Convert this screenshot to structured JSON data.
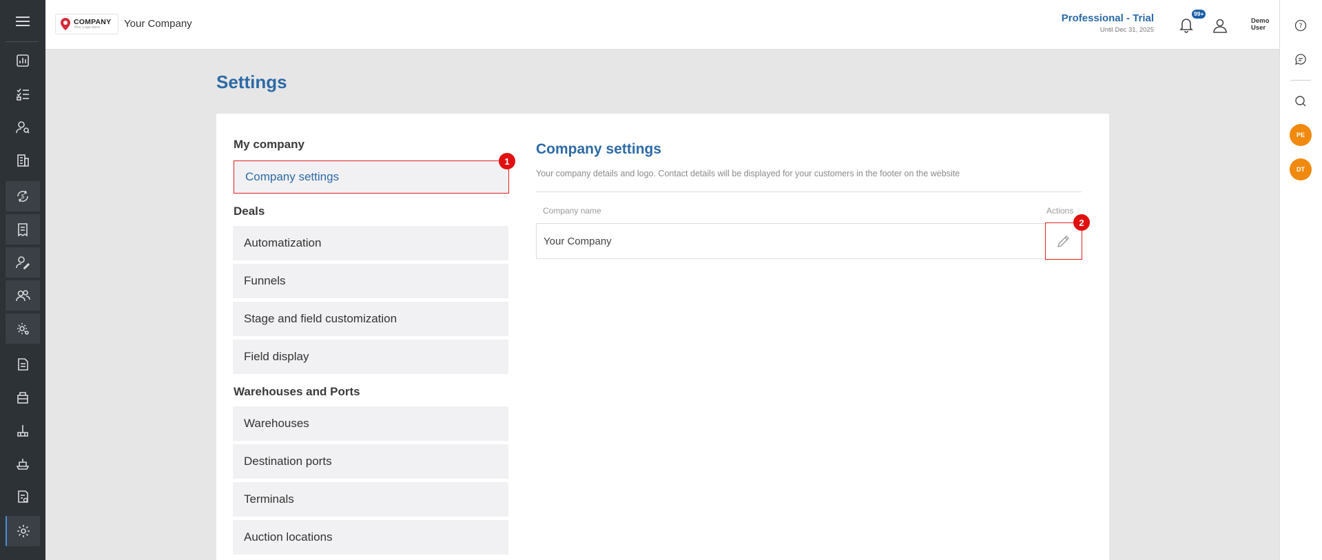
{
  "header": {
    "logo_main": "COMPANY",
    "logo_sub": "Your Logo Here",
    "company_name": "Your Company",
    "plan_title": "Professional - Trial",
    "plan_sub": "Until Dec 31, 2025",
    "notif_badge": "99+",
    "user_first": "Demo",
    "user_last": "User"
  },
  "page": {
    "title": "Settings"
  },
  "menu": {
    "sections": [
      {
        "title": "My company",
        "items": [
          "Company settings"
        ]
      },
      {
        "title": "Deals",
        "items": [
          "Automatization",
          "Funnels",
          "Stage and field customization",
          "Field display"
        ]
      },
      {
        "title": "Warehouses and Ports",
        "items": [
          "Warehouses",
          "Destination ports",
          "Terminals",
          "Auction locations"
        ]
      }
    ]
  },
  "company_settings": {
    "title": "Company settings",
    "description": "Your company details and logo. Contact details will be displayed for your customers in the footer on the website",
    "col_name": "Company name",
    "col_actions": "Actions",
    "row_value": "Your Company"
  },
  "markers": [
    "1",
    "2"
  ],
  "avatars": [
    "PE",
    "DT"
  ],
  "colors": {
    "accent": "#2c6aa6",
    "sidebar": "#2d3237",
    "marker": "#e01010",
    "avatar": "#f0890e",
    "badge": "#1a5ea8"
  }
}
